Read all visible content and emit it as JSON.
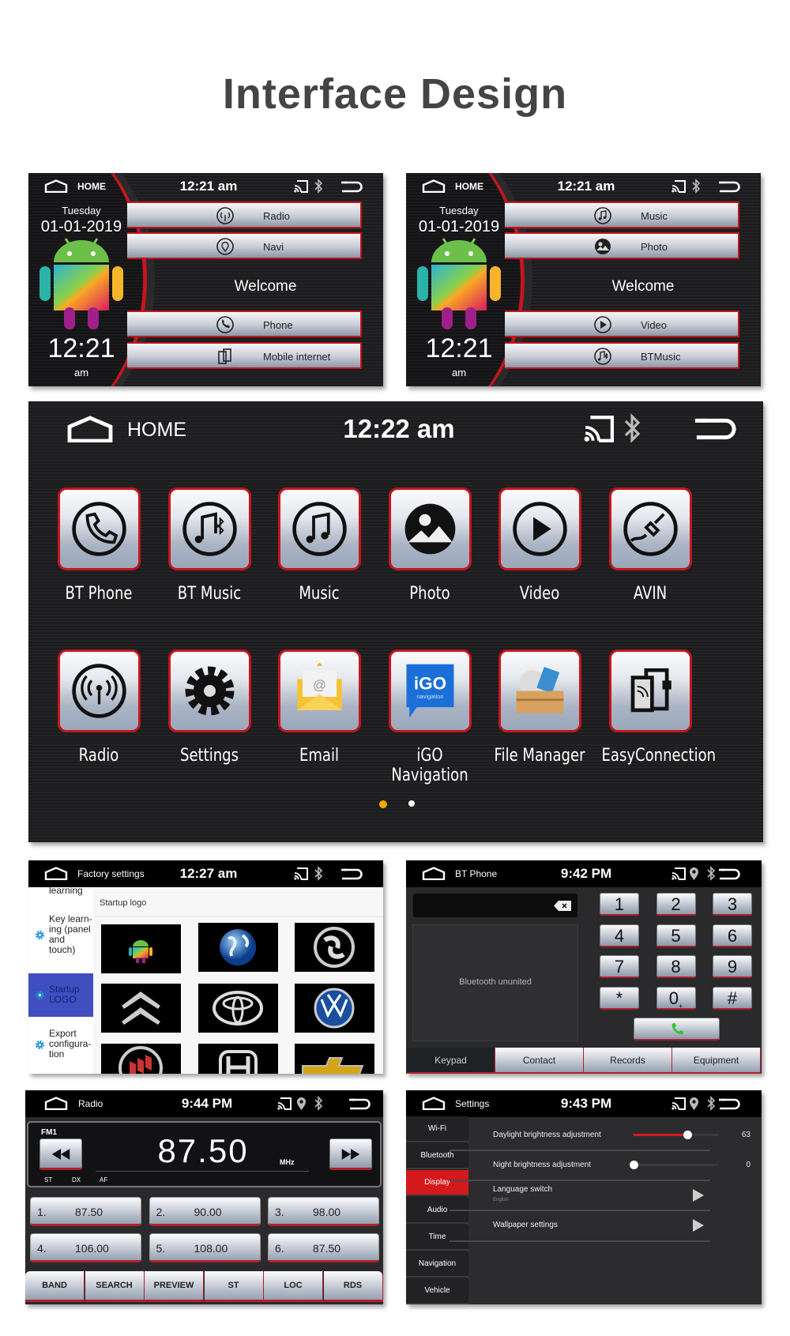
{
  "page_title": "Interface Design",
  "panel_a": {
    "header": {
      "label": "HOME",
      "time": "12:21 am"
    },
    "day": "Tuesday",
    "date": "01-01-2019",
    "clock": "12:21",
    "ampm": "am",
    "welcome": "Welcome",
    "buttons": [
      {
        "label": "Radio",
        "icon": "radio-antenna-icon"
      },
      {
        "label": "Navi",
        "icon": "map-pin-icon"
      },
      {
        "label": "Phone",
        "icon": "phone-icon"
      },
      {
        "label": "Mobile internet",
        "icon": "mobile-internet-icon"
      }
    ]
  },
  "panel_b": {
    "header": {
      "label": "HOME",
      "time": "12:21 am"
    },
    "day": "Tuesday",
    "date": "01-01-2019",
    "clock": "12:21",
    "ampm": "am",
    "welcome": "Welcome",
    "buttons": [
      {
        "label": "Music",
        "icon": "music-note-icon"
      },
      {
        "label": "Photo",
        "icon": "photo-icon"
      },
      {
        "label": "Video",
        "icon": "play-icon"
      },
      {
        "label": "BTMusic",
        "icon": "bt-music-icon"
      }
    ]
  },
  "home": {
    "header": {
      "label": "HOME",
      "time": "12:22 am"
    },
    "apps": [
      {
        "label": "BT Phone",
        "icon": "phone-icon"
      },
      {
        "label": "BT Music",
        "icon": "bt-music-icon"
      },
      {
        "label": "Music",
        "icon": "music-note-icon"
      },
      {
        "label": "Photo",
        "icon": "photo-icon"
      },
      {
        "label": "Video",
        "icon": "play-icon"
      },
      {
        "label": "AVIN",
        "icon": "avin-plug-icon"
      },
      {
        "label": "Radio",
        "icon": "radio-antenna-icon"
      },
      {
        "label": "Settings",
        "icon": "gear-icon"
      },
      {
        "label": "Email",
        "icon": "email-envelope-icon"
      },
      {
        "label": "iGO Navigation",
        "icon": "igo-logo-icon",
        "icon_text": "iGO",
        "icon_subtext": "navigation"
      },
      {
        "label": "File Manager",
        "icon": "file-box-icon"
      },
      {
        "label": "EasyConnection",
        "icon": "easy-connection-icon"
      }
    ],
    "pages": {
      "count": 2,
      "active": 1
    },
    "colors": {
      "active_dot": "#f5a800",
      "inactive_dot": "#ffffff",
      "accent": "#c4161c"
    }
  },
  "factory": {
    "header": {
      "label": "Factory settings",
      "time": "12:27 am"
    },
    "sidebar": [
      {
        "label": "learning",
        "active": false
      },
      {
        "label": "Key learn-ing (panel and touch)",
        "active": false
      },
      {
        "label": "Startup LOGO",
        "active": true
      },
      {
        "label": "Export configura-tion",
        "active": false
      }
    ],
    "section_title": "Startup logo",
    "logos": [
      "android-logo",
      "globe-logo",
      "dongfeng-logo",
      "citroen-logo",
      "toyota-logo",
      "volkswagen-logo",
      "buick-logo",
      "honda-logo",
      "chevrolet-logo"
    ],
    "colors": {
      "active_item": "#3f4fbf",
      "gear": "#1a8fe0"
    }
  },
  "bt_phone": {
    "header": {
      "label": "BT Phone",
      "time": "9:42 PM"
    },
    "status": "Bluetooth ununited",
    "keys": [
      "1",
      "2",
      "3",
      "4",
      "5",
      "6",
      "7",
      "8",
      "9",
      "*",
      "0",
      "#"
    ],
    "zero_sub": "+",
    "tabs": [
      {
        "label": "Keypad",
        "active": true
      },
      {
        "label": "Contact",
        "active": false
      },
      {
        "label": "Records",
        "active": false
      },
      {
        "label": "Equipment",
        "active": false
      }
    ]
  },
  "radio": {
    "header": {
      "label": "Radio",
      "time": "9:44 PM"
    },
    "band": "FM1",
    "frequency": "87.50",
    "unit": "MHz",
    "flags": [
      "ST",
      "DX",
      "AF"
    ],
    "presets": [
      {
        "num": "1.",
        "freq": "87.50"
      },
      {
        "num": "2.",
        "freq": "90.00"
      },
      {
        "num": "3.",
        "freq": "98.00"
      },
      {
        "num": "4.",
        "freq": "106.00"
      },
      {
        "num": "5.",
        "freq": "108.00"
      },
      {
        "num": "6.",
        "freq": "87.50"
      }
    ],
    "buttons": [
      "BAND",
      "SEARCH",
      "PREVIEW",
      "ST",
      "LOC",
      "RDS"
    ]
  },
  "settings": {
    "header": {
      "label": "Settings",
      "time": "9:43 PM"
    },
    "sidebar": [
      {
        "label": "Wi-Fi",
        "active": false
      },
      {
        "label": "Bluetooth",
        "active": false
      },
      {
        "label": "Display",
        "active": true
      },
      {
        "label": "Audio",
        "active": false
      },
      {
        "label": "Time",
        "active": false
      },
      {
        "label": "Navigation",
        "active": false
      },
      {
        "label": "Vehicle",
        "active": false
      }
    ],
    "daylight": {
      "label": "Daylight brightness adjustment",
      "value": "63",
      "percent": 63
    },
    "night": {
      "label": "Night brightness adjustment",
      "value": "0",
      "percent": 0
    },
    "language": {
      "label": "Language switch",
      "value": "English"
    },
    "wallpaper": {
      "label": "Wallpaper settings"
    },
    "colors": {
      "active_item": "#d4181c",
      "slider_fill": "#d4181c"
    }
  }
}
